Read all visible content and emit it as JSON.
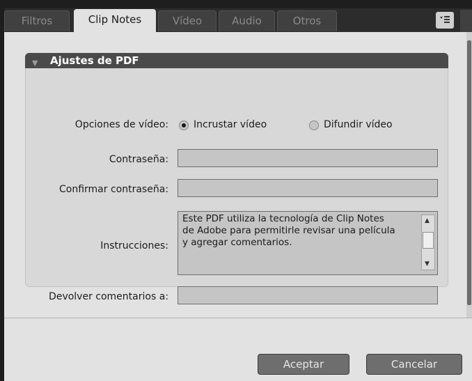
{
  "tabs": [
    {
      "label": "Filtros",
      "active": false
    },
    {
      "label": "Clip Notes",
      "active": true
    },
    {
      "label": "Vídeo",
      "active": false
    },
    {
      "label": "Audio",
      "active": false
    },
    {
      "label": "Otros",
      "active": false
    }
  ],
  "tab_menu_icon": "panel-menu-icon",
  "section": {
    "title": "Ajustes de PDF",
    "collapse_icon": "triangle-down-icon"
  },
  "video_options": {
    "label": "Opciones de vídeo:",
    "options": [
      {
        "label": "Incrustar vídeo",
        "selected": true
      },
      {
        "label": "Difundir vídeo",
        "selected": false
      }
    ]
  },
  "password": {
    "label": "Contraseña:",
    "value": ""
  },
  "confirm_password": {
    "label": "Confirmar contraseña:",
    "value": ""
  },
  "instructions": {
    "label": "Instrucciones:",
    "lines": [
      "Este PDF utiliza la tecnología de Clip Notes",
      "de Adobe para permitirle revisar una película",
      "y agregar comentarios."
    ]
  },
  "return_comments": {
    "label": "Devolver comentarios a:",
    "value": ""
  },
  "buttons": {
    "ok": "Aceptar",
    "cancel": "Cancelar"
  },
  "colors": {
    "panel_bg": "#e2e2e2",
    "header_bg": "#4a4a4a",
    "field_bg": "#c5c5c5",
    "button_bg": "#6e6e6e"
  }
}
